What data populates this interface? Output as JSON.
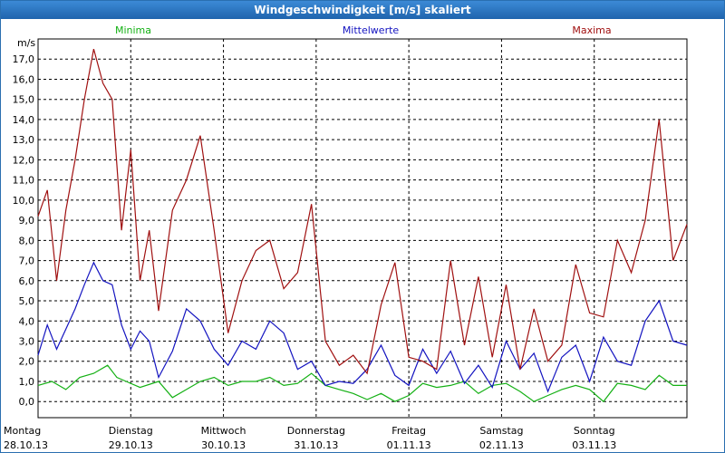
{
  "window": {
    "title": "Windgeschwindigkeit [m/s] skaliert"
  },
  "colors": {
    "min": "#14b014",
    "mean": "#1414c0",
    "max": "#a01010",
    "grid": "#000000"
  },
  "chart_data": {
    "type": "line",
    "title": "Windgeschwindigkeit [m/s] skaliert",
    "ylabel": "m/s",
    "ylim": [
      -0.8,
      18.0
    ],
    "yticks": [
      "0,0",
      "1,0",
      "2,0",
      "3,0",
      "4,0",
      "5,0",
      "6,0",
      "7,0",
      "8,0",
      "9,0",
      "10,0",
      "11,0",
      "12,0",
      "13,0",
      "14,0",
      "15,0",
      "16,0",
      "17,0"
    ],
    "x_range_days": [
      0,
      7
    ],
    "days": [
      {
        "weekday": "Montag",
        "date": "28.10.13"
      },
      {
        "weekday": "Dienstag",
        "date": "29.10.13"
      },
      {
        "weekday": "Mittwoch",
        "date": "30.10.13"
      },
      {
        "weekday": "Donnerstag",
        "date": "31.10.13"
      },
      {
        "weekday": "Freitag",
        "date": "01.11.13"
      },
      {
        "weekday": "Samstag",
        "date": "02.11.13"
      },
      {
        "weekday": "Sonntag",
        "date": "03.11.13"
      }
    ],
    "grid": true,
    "legend_position": "top",
    "series": [
      {
        "name": "Minima",
        "color": "#14b014",
        "x": [
          0,
          0.15,
          0.3,
          0.45,
          0.6,
          0.75,
          0.85,
          0.95,
          1.1,
          1.3,
          1.45,
          1.6,
          1.75,
          1.9,
          2.05,
          2.2,
          2.35,
          2.5,
          2.65,
          2.8,
          2.95,
          3.1,
          3.25,
          3.4,
          3.55,
          3.7,
          3.85,
          4.0,
          4.15,
          4.3,
          4.45,
          4.6,
          4.75,
          4.9,
          5.05,
          5.2,
          5.35,
          5.5,
          5.65,
          5.8,
          5.95,
          6.1,
          6.25,
          6.4,
          6.55,
          6.7,
          6.85,
          7.0
        ],
        "y": [
          0.8,
          1.0,
          0.6,
          1.2,
          1.4,
          1.8,
          1.2,
          1.0,
          0.7,
          1.0,
          0.2,
          0.6,
          1.0,
          1.2,
          0.8,
          1.0,
          1.0,
          1.2,
          0.8,
          0.9,
          1.4,
          0.8,
          0.6,
          0.4,
          0.1,
          0.4,
          0.0,
          0.3,
          0.9,
          0.7,
          0.8,
          1.0,
          0.4,
          0.8,
          0.9,
          0.5,
          0.0,
          0.3,
          0.6,
          0.8,
          0.6,
          0.0,
          0.9,
          0.8,
          0.6,
          1.3,
          0.8,
          0.8
        ]
      },
      {
        "name": "Mittelwerte",
        "color": "#1414c0",
        "x": [
          0,
          0.1,
          0.2,
          0.3,
          0.4,
          0.5,
          0.6,
          0.7,
          0.8,
          0.9,
          1.0,
          1.1,
          1.2,
          1.3,
          1.45,
          1.6,
          1.75,
          1.9,
          2.05,
          2.2,
          2.35,
          2.5,
          2.65,
          2.8,
          2.95,
          3.1,
          3.25,
          3.4,
          3.55,
          3.7,
          3.85,
          4.0,
          4.15,
          4.3,
          4.45,
          4.6,
          4.75,
          4.9,
          5.05,
          5.2,
          5.35,
          5.5,
          5.65,
          5.8,
          5.95,
          6.1,
          6.25,
          6.4,
          6.55,
          6.7,
          6.85,
          7.0
        ],
        "y": [
          2.3,
          3.8,
          2.6,
          3.6,
          4.6,
          5.8,
          6.9,
          6.0,
          5.8,
          3.8,
          2.6,
          3.5,
          3.0,
          1.2,
          2.5,
          4.6,
          4.0,
          2.6,
          1.8,
          3.0,
          2.6,
          4.0,
          3.4,
          1.6,
          2.0,
          0.8,
          1.0,
          0.9,
          1.6,
          2.8,
          1.3,
          0.8,
          2.6,
          1.4,
          2.5,
          0.9,
          1.8,
          0.7,
          3.0,
          1.6,
          2.4,
          0.5,
          2.2,
          2.8,
          1.0,
          3.2,
          2.0,
          1.8,
          4.0,
          5.0,
          3.0,
          2.8
        ]
      },
      {
        "name": "Maxima",
        "color": "#a01010",
        "x": [
          0,
          0.1,
          0.2,
          0.3,
          0.4,
          0.5,
          0.6,
          0.7,
          0.8,
          0.9,
          1.0,
          1.1,
          1.2,
          1.3,
          1.45,
          1.6,
          1.75,
          1.9,
          2.05,
          2.2,
          2.35,
          2.5,
          2.65,
          2.8,
          2.95,
          3.1,
          3.25,
          3.4,
          3.55,
          3.7,
          3.85,
          4.0,
          4.15,
          4.3,
          4.45,
          4.6,
          4.75,
          4.9,
          5.05,
          5.2,
          5.35,
          5.5,
          5.65,
          5.8,
          5.95,
          6.1,
          6.25,
          6.4,
          6.55,
          6.7,
          6.85,
          7.0
        ],
        "y": [
          9.2,
          10.5,
          6.0,
          9.5,
          12.0,
          15.0,
          17.5,
          15.8,
          15.0,
          8.5,
          12.5,
          6.0,
          8.5,
          4.5,
          9.5,
          11.0,
          13.2,
          8.5,
          3.4,
          6.0,
          7.5,
          8.0,
          5.6,
          6.4,
          9.8,
          3.0,
          1.8,
          2.3,
          1.4,
          4.8,
          6.9,
          2.2,
          2.0,
          1.6,
          7.0,
          2.8,
          6.2,
          2.2,
          5.8,
          1.6,
          4.6,
          2.0,
          2.8,
          6.8,
          4.4,
          4.2,
          8.0,
          6.4,
          9.0,
          14.0,
          7.0,
          8.8
        ]
      }
    ]
  }
}
